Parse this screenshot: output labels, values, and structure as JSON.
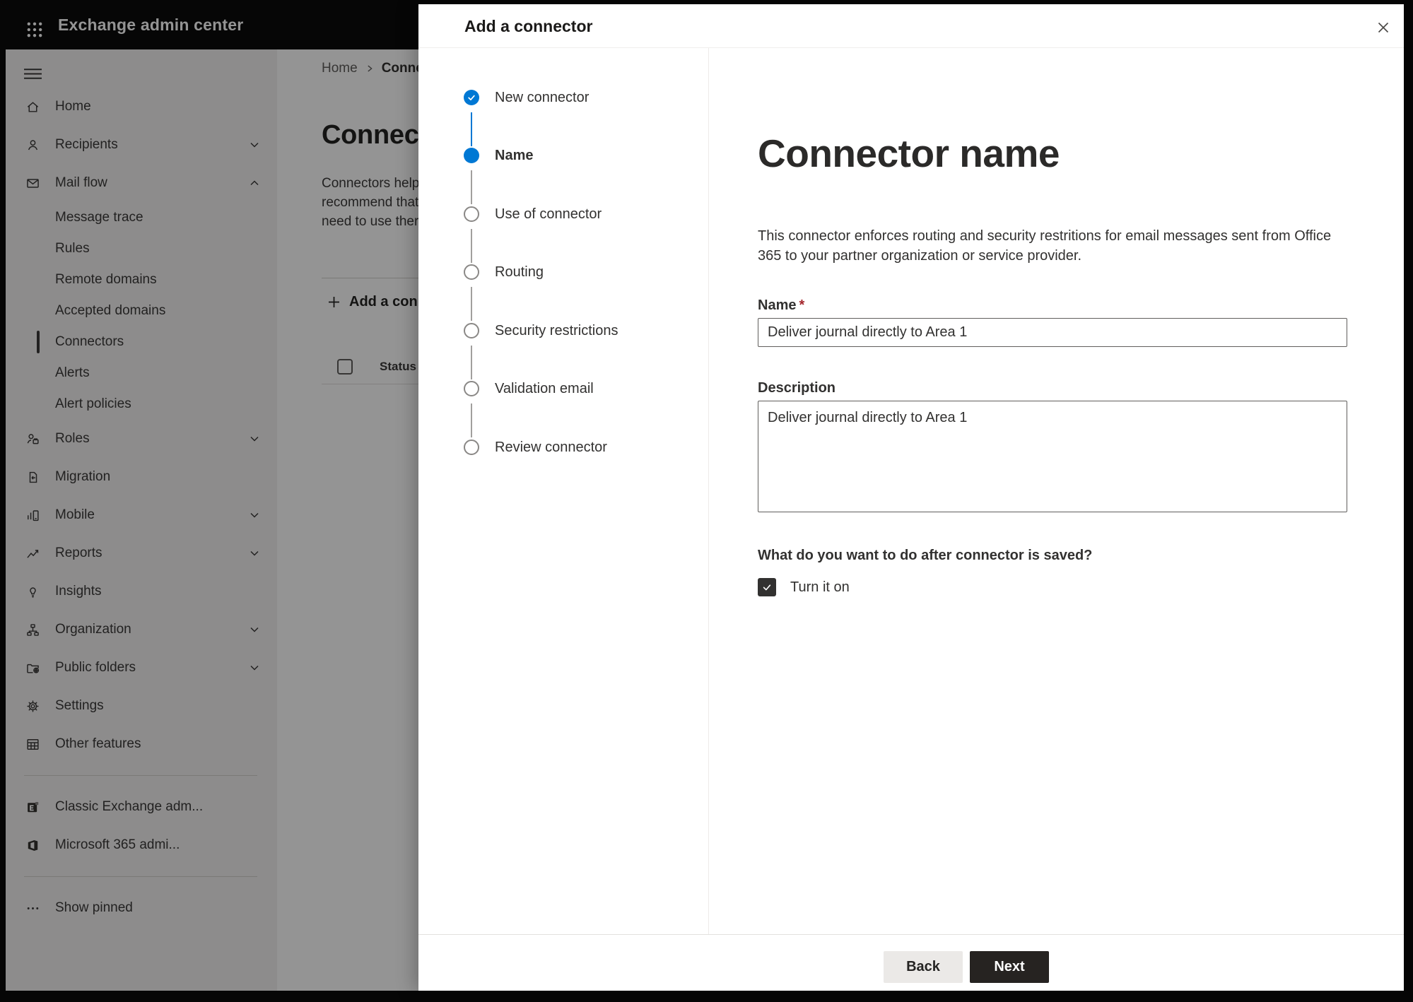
{
  "topbar": {
    "title": "Exchange admin center"
  },
  "sidebar": {
    "items": [
      {
        "label": "Home",
        "icon": "home"
      },
      {
        "label": "Recipients",
        "icon": "person",
        "chevron": "down"
      },
      {
        "label": "Mail flow",
        "icon": "mail",
        "chevron": "up",
        "expanded": true
      },
      {
        "label": "Message trace",
        "sub": true
      },
      {
        "label": "Rules",
        "sub": true
      },
      {
        "label": "Remote domains",
        "sub": true
      },
      {
        "label": "Accepted domains",
        "sub": true
      },
      {
        "label": "Connectors",
        "sub": true,
        "selected": true
      },
      {
        "label": "Alerts",
        "sub": true
      },
      {
        "label": "Alert policies",
        "sub": true
      },
      {
        "label": "Roles",
        "icon": "roles",
        "chevron": "down"
      },
      {
        "label": "Migration",
        "icon": "migration"
      },
      {
        "label": "Mobile",
        "icon": "mobile",
        "chevron": "down"
      },
      {
        "label": "Reports",
        "icon": "reports",
        "chevron": "down"
      },
      {
        "label": "Insights",
        "icon": "insights"
      },
      {
        "label": "Organization",
        "icon": "organization",
        "chevron": "down"
      },
      {
        "label": "Public folders",
        "icon": "public-folders",
        "chevron": "down"
      },
      {
        "label": "Settings",
        "icon": "settings"
      },
      {
        "label": "Other features",
        "icon": "other-features"
      },
      {
        "label": "Classic Exchange adm...",
        "icon": "exchange-logo"
      },
      {
        "label": "Microsoft 365 admi...",
        "icon": "office-logo"
      },
      {
        "label": "Show pinned",
        "icon": "ellipsis"
      }
    ]
  },
  "page": {
    "breadcrumb": [
      "Home",
      "Conne"
    ],
    "heading": "Connect",
    "description_lines": [
      "Connectors help",
      "recommend that",
      "need to use ther"
    ],
    "add_button": "Add a conn",
    "status_header": "Status"
  },
  "dialog": {
    "title": "Add a connector",
    "steps": [
      {
        "label": "New connector",
        "state": "done"
      },
      {
        "label": "Name",
        "state": "active"
      },
      {
        "label": "Use of connector",
        "state": "upcoming"
      },
      {
        "label": "Routing",
        "state": "upcoming"
      },
      {
        "label": "Security restrictions",
        "state": "upcoming"
      },
      {
        "label": "Validation email",
        "state": "upcoming"
      },
      {
        "label": "Review connector",
        "state": "upcoming"
      }
    ],
    "content": {
      "heading": "Connector name",
      "description": "This connector enforces routing and security restritions for email messages sent from Office 365 to your partner organization or service provider.",
      "name_field": {
        "label": "Name",
        "required": "*",
        "value": "Deliver journal directly to Area 1"
      },
      "description_field": {
        "label": "Description",
        "value": "Deliver journal directly to Area 1"
      },
      "after_save_question": "What do you want to do after connector is saved?",
      "turn_on": {
        "label": "Turn it on",
        "checked": true
      }
    },
    "footer": {
      "back": "Back",
      "next": "Next"
    }
  },
  "colors": {
    "accent_blue": "#0078d4",
    "dark_button": "#262321",
    "text": "#323130",
    "required_red": "#a4262c",
    "sidebar_bg": "#f3f2f1"
  }
}
